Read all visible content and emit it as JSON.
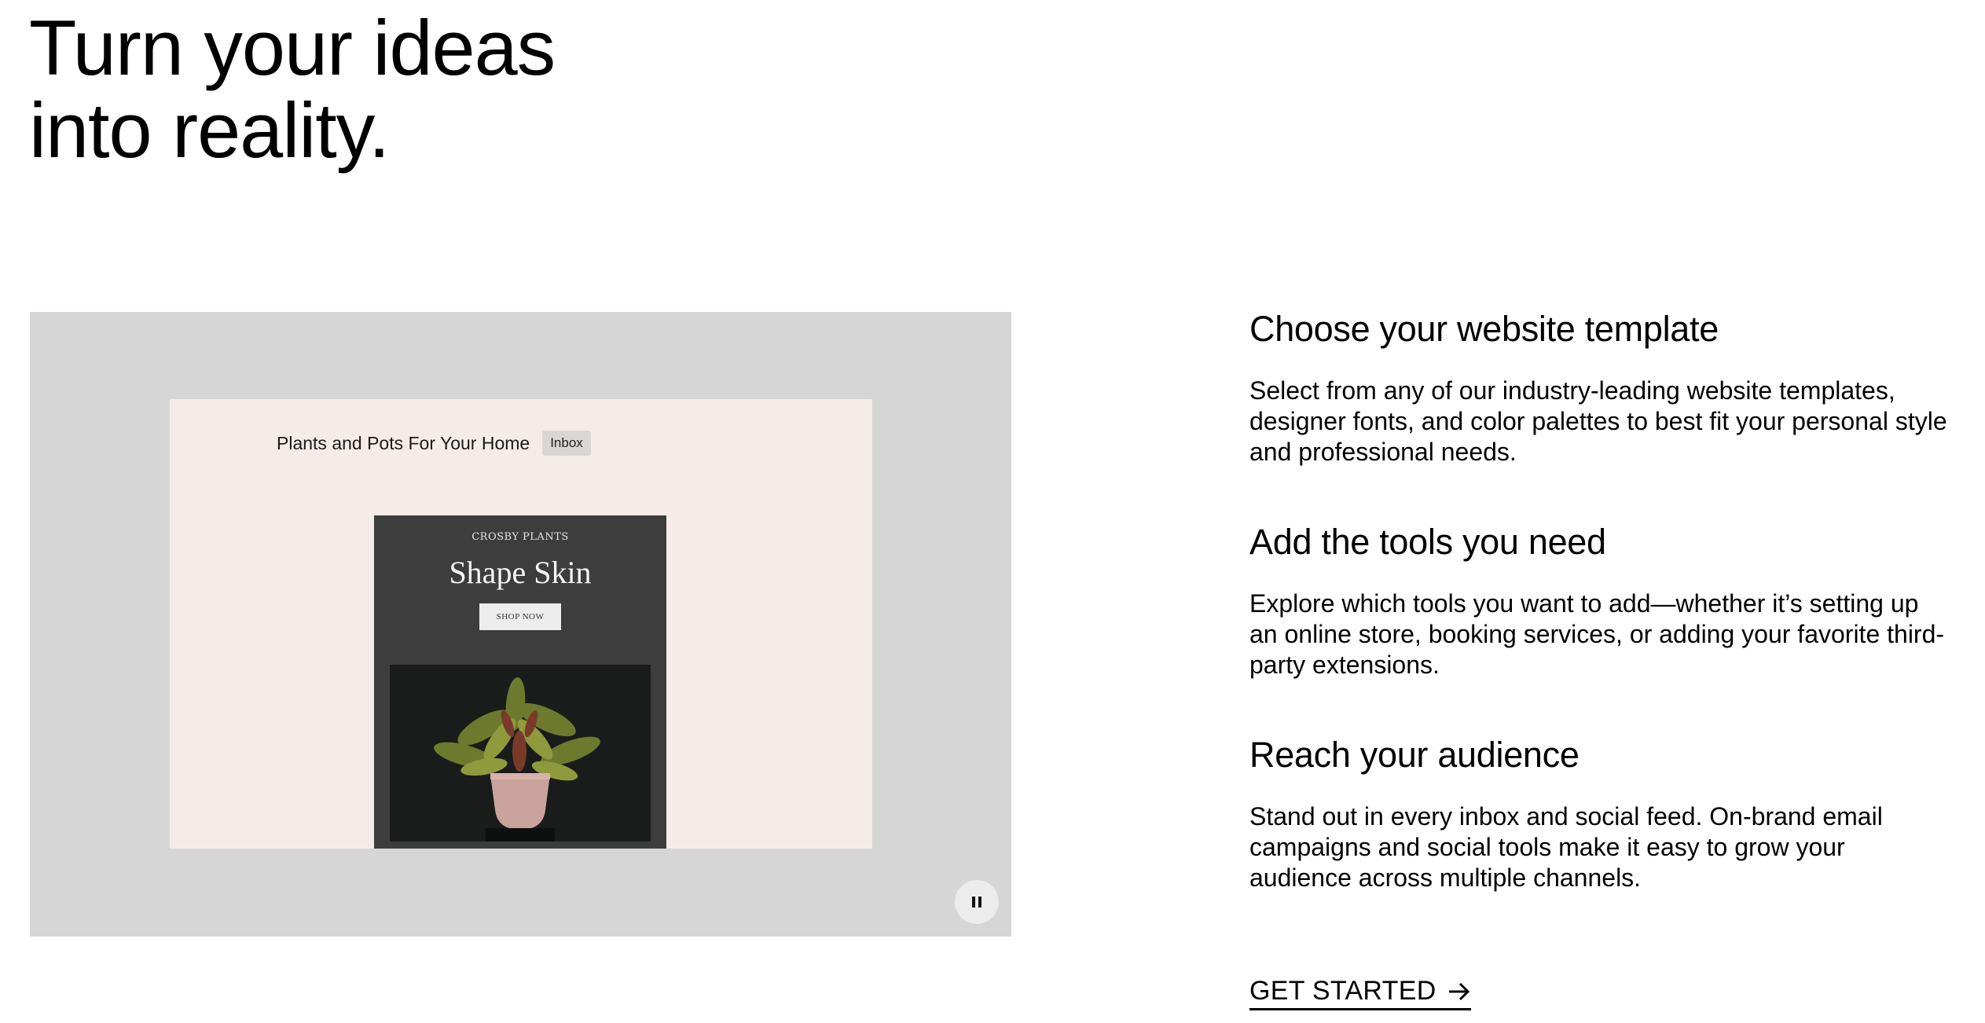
{
  "hero": {
    "line1": "Turn your ideas",
    "line2": "into reality."
  },
  "media": {
    "email_subject": "Plants and Pots For Your Home",
    "inbox_badge": "Inbox",
    "brand": "CROSBY PLANTS",
    "headline": "Shape Skin",
    "button_label": "SHOP NOW",
    "pause_icon": "pause-icon"
  },
  "features": [
    {
      "title": "Choose your website template",
      "body": "Select from any of our industry-leading website templates, designer fonts, and color palettes to best fit your personal style and professional needs."
    },
    {
      "title": "Add the tools you need",
      "body": "Explore which tools you want to add—whether it’s setting up an online store, booking services, or adding your favorite third-party extensions."
    },
    {
      "title": "Reach your audience",
      "body": "Stand out in every inbox and social feed. On-brand email campaigns and social tools make it easy to grow your audience across multiple channels."
    }
  ],
  "cta": {
    "label": "GET STARTED",
    "icon": "arrow-right-icon"
  },
  "colors": {
    "media_background": "#d6d6d6",
    "email_background": "#f5ecea",
    "card_background": "#3d3d3d"
  }
}
